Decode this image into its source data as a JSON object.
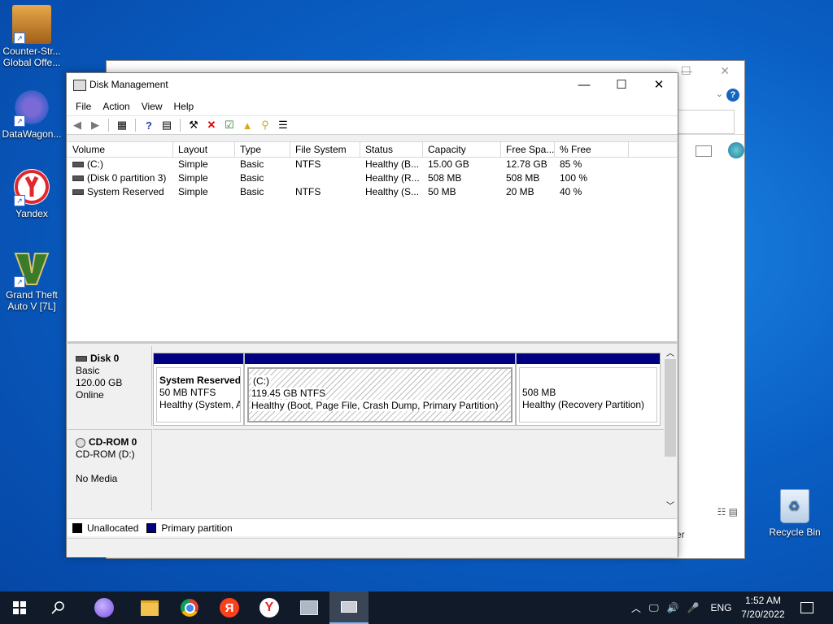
{
  "desktop": {
    "icons": [
      {
        "label": "Counter-Str... Global Offe..."
      },
      {
        "label": "DataWagon..."
      },
      {
        "label": "Yandex"
      },
      {
        "label": "Grand Theft Auto V [7L]"
      }
    ],
    "recycle_bin": "Recycle Bin"
  },
  "bg_window": {
    "partial_text": "er",
    "help_icon": "?"
  },
  "window": {
    "title": "Disk Management",
    "menu": [
      "File",
      "Action",
      "View",
      "Help"
    ]
  },
  "volumes": {
    "columns": [
      "Volume",
      "Layout",
      "Type",
      "File System",
      "Status",
      "Capacity",
      "Free Spa...",
      "% Free"
    ],
    "rows": [
      [
        "(C:)",
        "Simple",
        "Basic",
        "NTFS",
        "Healthy (B...",
        "15.00 GB",
        "12.78 GB",
        "85 %"
      ],
      [
        "(Disk 0 partition 3)",
        "Simple",
        "Basic",
        "",
        "Healthy (R...",
        "508 MB",
        "508 MB",
        "100 %"
      ],
      [
        "System Reserved",
        "Simple",
        "Basic",
        "NTFS",
        "Healthy (S...",
        "50 MB",
        "20 MB",
        "40 %"
      ]
    ]
  },
  "disks": [
    {
      "name": "Disk 0",
      "type": "Basic",
      "size": "120.00 GB",
      "status": "Online",
      "partitions": [
        {
          "title": "System Reserved",
          "fs": "50 MB NTFS",
          "status": "Healthy (System, A"
        },
        {
          "title": "(C:)",
          "fs": "119.45 GB NTFS",
          "status": "Healthy (Boot, Page File, Crash Dump, Primary Partition)"
        },
        {
          "title": "",
          "fs": "508 MB",
          "status": "Healthy (Recovery Partition)"
        }
      ]
    },
    {
      "name": "CD-ROM 0",
      "type": "CD-ROM (D:)",
      "status": "No Media"
    }
  ],
  "legend": [
    "Unallocated",
    "Primary partition"
  ],
  "colors": {
    "unallocated": "#000000",
    "primary": "#000080"
  },
  "taskbar": {
    "lang": "ENG",
    "time": "1:52 AM",
    "date": "7/20/2022"
  }
}
